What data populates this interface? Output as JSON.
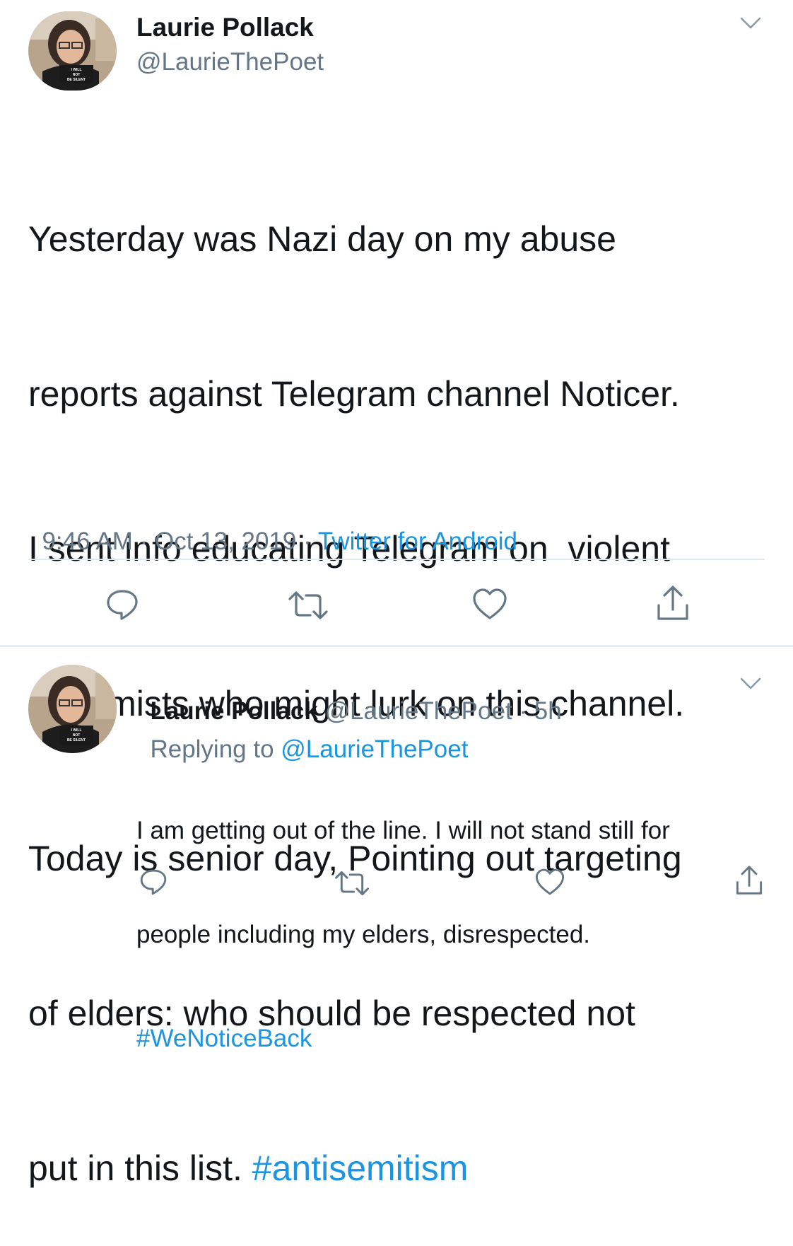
{
  "main_tweet": {
    "author_name": "Laurie Pollack",
    "handle": "@LaurieThePoet",
    "avatar_sign_text": "I WILL NOT BE SILENT",
    "text_lines": [
      "Yesterday was Nazi day on my abuse",
      "reports against Telegram channel Noticer.",
      "I sent info educating Telegram on  violent",
      "extremists who might lurk on this channel.",
      "Today is senior day, Pointing out targeting",
      "of elders: who should be respected not",
      "put in this list. "
    ],
    "hashtag": "#antisemitism",
    "time": "9:46 AM",
    "sep1": " · ",
    "date": "Oct 13, 2019",
    "sep2": " · ",
    "source": "Twitter for Android"
  },
  "reply_tweet": {
    "author_name": "Laurie Pollack",
    "handle": "@LaurieThePoet",
    "time_ago": " · 5h",
    "replying_label": "Replying to ",
    "replying_handle": "@LaurieThePoet",
    "text_lines": [
      "I am getting out of the line. I will not stand still for",
      "people including my elders, disrespected."
    ],
    "hashtag": "#WeNoticeBack"
  },
  "icons": {
    "menu": "chevron-down-icon",
    "reply": "reply-icon",
    "retweet": "retweet-icon",
    "like": "heart-icon",
    "share": "share-icon"
  },
  "colors": {
    "link": "#1b95e0",
    "secondary_text": "#657786",
    "icon": "#657786",
    "divider": "#e1e8ed"
  }
}
